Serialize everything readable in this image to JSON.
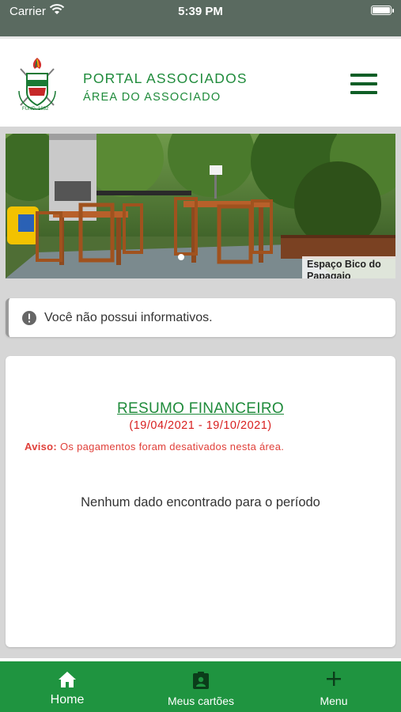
{
  "status_bar": {
    "carrier": "Carrier",
    "time": "5:39 PM"
  },
  "header": {
    "title": "PORTAL ASSOCIADOS",
    "subtitle": "ÁREA DO ASSOCIADO",
    "menu_icon": "hamburger-icon"
  },
  "banner": {
    "caption": "Espaço Bico do Papagaio",
    "slide_index": 1
  },
  "notice": {
    "icon": "info-icon",
    "text": "Você não possui informativos."
  },
  "financial_summary": {
    "title": "RESUMO FINANCEIRO",
    "period": "(19/04/2021 - 19/10/2021)",
    "warning_label": "Aviso:",
    "warning_text": "Os pagamentos foram desativados nesta área.",
    "empty_message": "Nenhum dado encontrado para o período"
  },
  "bottom_nav": {
    "items": [
      {
        "label": "Home",
        "icon": "home-icon",
        "active": true
      },
      {
        "label": "Meus cartões",
        "icon": "id-badge-icon",
        "active": false
      },
      {
        "label": "Menu",
        "icon": "plus-icon",
        "active": false
      }
    ]
  },
  "colors": {
    "brand_green": "#1f8b3b",
    "nav_green": "#1f9440",
    "period_red": "#d81f1f",
    "warning_red": "#e0403a"
  }
}
